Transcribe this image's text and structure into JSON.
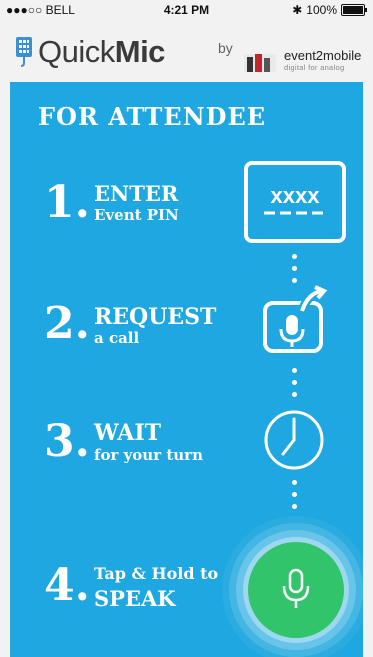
{
  "status": {
    "carrier": "●●●○○ BELL",
    "wifi": "wifi-icon",
    "time": "4:21 PM",
    "bluetooth": "✱",
    "battery": "100%"
  },
  "header": {
    "app_name_light": "Quick",
    "app_name_bold": "Mic",
    "by": "by",
    "partner_name": "event2mobile",
    "partner_tagline": "digital for analog"
  },
  "main": {
    "heading": "FOR ATTENDEE",
    "steps": [
      {
        "num": "1.",
        "title": "ENTER",
        "subtitle": "Event PIN",
        "icon": "pin-card-icon",
        "pin_mask": "xxxx"
      },
      {
        "num": "2.",
        "title": "REQUEST",
        "subtitle": "a call",
        "icon": "request-call-icon"
      },
      {
        "num": "3.",
        "title": "WAIT",
        "subtitle": "for your turn",
        "icon": "clock-icon"
      },
      {
        "num": "4.",
        "title": "Tap & Hold to",
        "subtitle": "SPEAK",
        "icon": "microphone-icon"
      }
    ]
  },
  "colors": {
    "panel": "#1ea7e0",
    "mic_button": "#31c46a"
  }
}
